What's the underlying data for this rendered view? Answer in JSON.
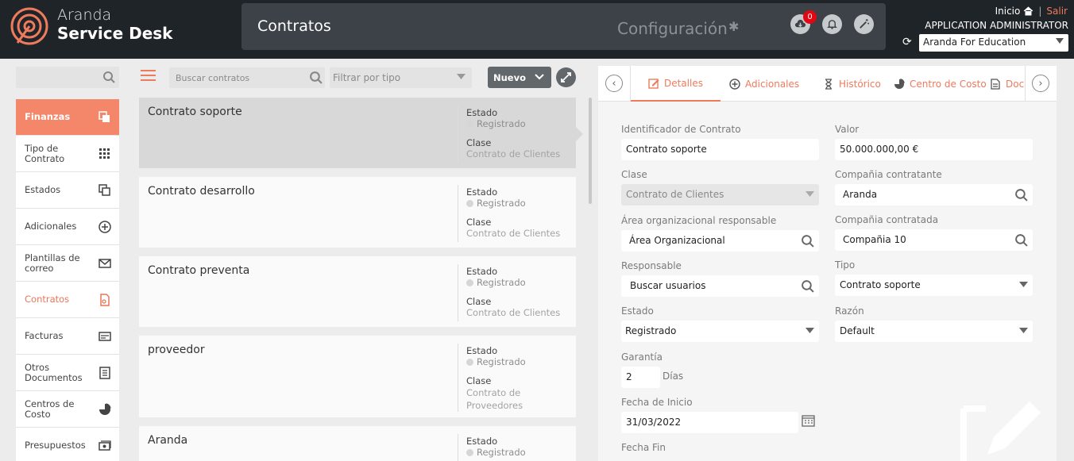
{
  "header": {
    "brand_line1": "Aranda",
    "brand_line2": "Service Desk",
    "page_title": "Contratos",
    "config_label": "Configuración",
    "notification_count": "0",
    "inicio": "Inicio",
    "salir": "Salir",
    "user_name": "APPLICATION ADMINISTRATOR",
    "project": "Aranda For Education"
  },
  "sidebar": {
    "items": [
      {
        "label": "Finanzas",
        "icon": "copy-icon"
      },
      {
        "label": "Tipo de Contrato",
        "icon": "grid-icon"
      },
      {
        "label": "Estados",
        "icon": "copy-icon"
      },
      {
        "label": "Adicionales",
        "icon": "plus-circle-icon"
      },
      {
        "label": "Plantillas de correo",
        "icon": "envelope-icon"
      },
      {
        "label": "Contratos",
        "icon": "contract-icon"
      },
      {
        "label": "Facturas",
        "icon": "card-icon"
      },
      {
        "label": "Otros Documentos",
        "icon": "document-icon"
      },
      {
        "label": "Centros de Costo",
        "icon": "pie-icon"
      },
      {
        "label": "Presupuestos",
        "icon": "money-icon"
      }
    ]
  },
  "list": {
    "search_placeholder": "Buscar contratos",
    "filter_placeholder": "Filtrar por tipo",
    "new_label": "Nuevo",
    "estado_label": "Estado",
    "clase_label": "Clase",
    "items": [
      {
        "name": "Contrato soporte",
        "estado": "Registrado",
        "clase": "Contrato de Clientes"
      },
      {
        "name": "Contrato desarrollo",
        "estado": "Registrado",
        "clase": "Contrato de Clientes"
      },
      {
        "name": "Contrato preventa",
        "estado": "Registrado",
        "clase": "Contrato de Clientes"
      },
      {
        "name": "proveedor",
        "estado": "Registrado",
        "clase": "Contrato de Proveedores"
      },
      {
        "name": "Aranda",
        "estado": "Registrado",
        "clase": ""
      }
    ]
  },
  "detail": {
    "tabs": [
      {
        "label": "Detalles",
        "icon": "edit-icon"
      },
      {
        "label": "Adicionales",
        "icon": "plus-circle-icon"
      },
      {
        "label": "Histórico",
        "icon": "hourglass-icon"
      },
      {
        "label": "Centro de Costo",
        "icon": "pie-icon"
      },
      {
        "label": "Doc",
        "icon": "document-icon"
      }
    ],
    "fields": {
      "identificador": {
        "label": "Identificador de Contrato",
        "value": "Contrato soporte"
      },
      "valor": {
        "label": "Valor",
        "value": "50.000.000,00 €"
      },
      "clase": {
        "label": "Clase",
        "value": "Contrato de Clientes"
      },
      "compania_contratante": {
        "label": "Compañia contratante",
        "value": "Aranda"
      },
      "area": {
        "label": "Área organizacional responsable",
        "value": "Área Organizacional"
      },
      "compania_contratada": {
        "label": "Compañia contratada",
        "value": "Compañia 10"
      },
      "responsable": {
        "label": "Responsable",
        "value": "Buscar usuarios"
      },
      "tipo": {
        "label": "Tipo",
        "value": "Contrato soporte"
      },
      "estado": {
        "label": "Estado",
        "value": "Registrado"
      },
      "razon": {
        "label": "Razón",
        "value": "Default"
      },
      "garantia": {
        "label": "Garantía",
        "value": "2",
        "unit": "Días"
      },
      "fecha_inicio": {
        "label": "Fecha de Inicio",
        "value": "31/03/2022"
      },
      "fecha_fin": {
        "label": "Fecha Fin"
      }
    }
  },
  "colors": {
    "accent": "#ee7a5c",
    "header_bg": "#1f2429",
    "active_nav": "#f4876a",
    "badge": "#e30613"
  }
}
